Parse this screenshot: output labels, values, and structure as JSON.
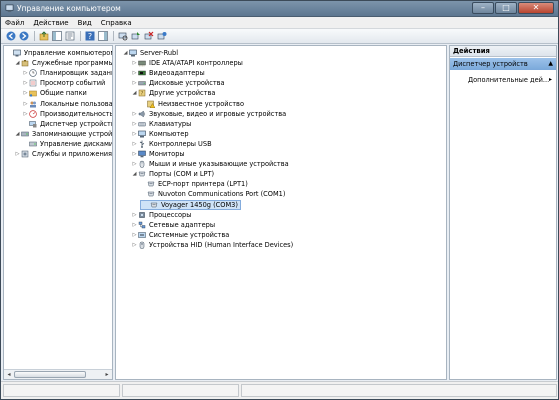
{
  "window": {
    "title": "Управление компьютером",
    "min": "–",
    "max": "□",
    "close": "✕"
  },
  "menu": [
    "Файл",
    "Действие",
    "Вид",
    "Справка"
  ],
  "toolbar_icons": [
    "back-icon",
    "forward-icon",
    "up-folder-icon",
    "show-hide-tree-icon",
    "properties-icon",
    "help-icon",
    "show-hide-action-icon",
    "scan-hardware-icon",
    "update-driver-icon",
    "disable-device-icon",
    "uninstall-device-icon",
    "enable-device-icon"
  ],
  "left_tree": [
    {
      "label": "Управление компьютером (л",
      "level": 0,
      "exp": "",
      "icon": "computer-mgmt-icon"
    },
    {
      "label": "Служебные программы",
      "level": 1,
      "exp": "◢",
      "icon": "tools-icon"
    },
    {
      "label": "Планировщик заданий",
      "level": 2,
      "exp": "▷",
      "icon": "clock-icon"
    },
    {
      "label": "Просмотр событий",
      "level": 2,
      "exp": "▷",
      "icon": "event-viewer-icon"
    },
    {
      "label": "Общие папки",
      "level": 2,
      "exp": "▷",
      "icon": "shared-folder-icon"
    },
    {
      "label": "Локальные пользовате",
      "level": 2,
      "exp": "▷",
      "icon": "users-icon"
    },
    {
      "label": "Производительность",
      "level": 2,
      "exp": "▷",
      "icon": "performance-icon"
    },
    {
      "label": "Диспетчер устройств",
      "level": 2,
      "exp": "",
      "icon": "device-manager-icon"
    },
    {
      "label": "Запоминающие устройст",
      "level": 1,
      "exp": "◢",
      "icon": "storage-icon"
    },
    {
      "label": "Управление дисками",
      "level": 2,
      "exp": "",
      "icon": "disk-mgmt-icon"
    },
    {
      "label": "Службы и приложения",
      "level": 1,
      "exp": "▷",
      "icon": "services-icon"
    }
  ],
  "device_tree": [
    {
      "label": "Server-Rubl",
      "level": 0,
      "exp": "◢",
      "icon": "computer-icon"
    },
    {
      "label": "IDE ATA/ATAPI контроллеры",
      "level": 1,
      "exp": "▷",
      "icon": "ide-controller-icon"
    },
    {
      "label": "Видеоадаптеры",
      "level": 1,
      "exp": "▷",
      "icon": "display-adapter-icon"
    },
    {
      "label": "Дисковые устройства",
      "level": 1,
      "exp": "▷",
      "icon": "disk-drive-icon"
    },
    {
      "label": "Другие устройства",
      "level": 1,
      "exp": "◢",
      "icon": "other-devices-icon"
    },
    {
      "label": "Неизвестное устройство",
      "level": 2,
      "exp": "",
      "icon": "unknown-device-warning-icon"
    },
    {
      "label": "Звуковые, видео и игровые устройства",
      "level": 1,
      "exp": "▷",
      "icon": "sound-icon"
    },
    {
      "label": "Клавиатуры",
      "level": 1,
      "exp": "▷",
      "icon": "keyboard-icon"
    },
    {
      "label": "Компьютер",
      "level": 1,
      "exp": "▷",
      "icon": "computer-icon"
    },
    {
      "label": "Контроллеры USB",
      "level": 1,
      "exp": "▷",
      "icon": "usb-icon"
    },
    {
      "label": "Мониторы",
      "level": 1,
      "exp": "▷",
      "icon": "monitor-icon"
    },
    {
      "label": "Мыши и иные указывающие устройства",
      "level": 1,
      "exp": "▷",
      "icon": "mouse-icon"
    },
    {
      "label": "Порты (COM и LPT)",
      "level": 1,
      "exp": "◢",
      "icon": "port-icon"
    },
    {
      "label": "ECP-порт принтера (LPT1)",
      "level": 2,
      "exp": "",
      "icon": "port-icon"
    },
    {
      "label": "Nuvoton Communications Port (COM1)",
      "level": 2,
      "exp": "",
      "icon": "port-icon"
    },
    {
      "label": "Voyager 1450g (COM3)",
      "level": 2,
      "exp": "",
      "icon": "port-icon",
      "selected": true
    },
    {
      "label": "Процессоры",
      "level": 1,
      "exp": "▷",
      "icon": "processor-icon"
    },
    {
      "label": "Сетевые адаптеры",
      "level": 1,
      "exp": "▷",
      "icon": "network-adapter-icon"
    },
    {
      "label": "Системные устройства",
      "level": 1,
      "exp": "▷",
      "icon": "system-device-icon"
    },
    {
      "label": "Устройства HID (Human Interface Devices)",
      "level": 1,
      "exp": "▷",
      "icon": "hid-icon"
    }
  ],
  "actions": {
    "header": "Действия",
    "section": "Диспетчер устройств",
    "section_arrow": "▲",
    "item": "Дополнительные дей...",
    "item_arrow": "▸"
  },
  "scroll": {
    "left_arrow": "◂",
    "right_arrow": "▸"
  },
  "colors": {
    "titlebar": "#6a839c",
    "selection": "#cfe3f7",
    "action_header": "#8db6e3"
  }
}
